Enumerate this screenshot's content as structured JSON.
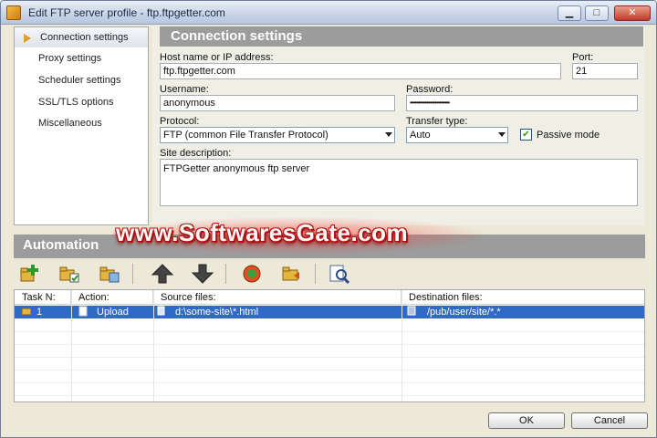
{
  "window": {
    "title": "Edit FTP server profile - ftp.ftpgetter.com",
    "minimize": "▁",
    "maximize": "□",
    "close": "✕"
  },
  "nav": {
    "items": [
      {
        "label": "Connection settings",
        "active": true
      },
      {
        "label": "Proxy settings",
        "active": false
      },
      {
        "label": "Scheduler settings",
        "active": false
      },
      {
        "label": "SSL/TLS options",
        "active": false
      },
      {
        "label": "Miscellaneous",
        "active": false
      }
    ]
  },
  "connection": {
    "heading": "Connection settings",
    "host_label": "Host name or IP address:",
    "host_value": "ftp.ftpgetter.com",
    "port_label": "Port:",
    "port_value": "21",
    "username_label": "Username:",
    "username_value": "anonymous",
    "password_label": "Password:",
    "password_value": "••••••••••••••••••••••••",
    "protocol_label": "Protocol:",
    "protocol_value": "FTP (common File Transfer Protocol)",
    "transfer_label": "Transfer type:",
    "transfer_value": "Auto",
    "passive_label": "Passive mode",
    "passive_checked": true,
    "site_desc_label": "Site description:",
    "site_desc_value": "FTPGetter anonymous ftp server"
  },
  "automation": {
    "heading": "Automation",
    "toolbar": [
      "add-task-icon",
      "edit-task-icon",
      "copy-task-icon",
      "move-up-icon",
      "move-down-icon",
      "run-task-icon",
      "open-folder-icon",
      "search-icon"
    ],
    "columns": [
      "Task N:",
      "Action:",
      "Source files:",
      "Destination files:"
    ],
    "rows": [
      {
        "task": "1",
        "action": "Upload",
        "source": "d:\\some-site\\*.html",
        "destination": "/pub/user/site/*.*"
      }
    ]
  },
  "buttons": {
    "ok": "OK",
    "cancel": "Cancel"
  },
  "watermark": "www.SoftwaresGate.com",
  "colors": {
    "selection": "#3169c6",
    "header_band": "#9c9c9c",
    "watermark_red": "#b01010"
  }
}
